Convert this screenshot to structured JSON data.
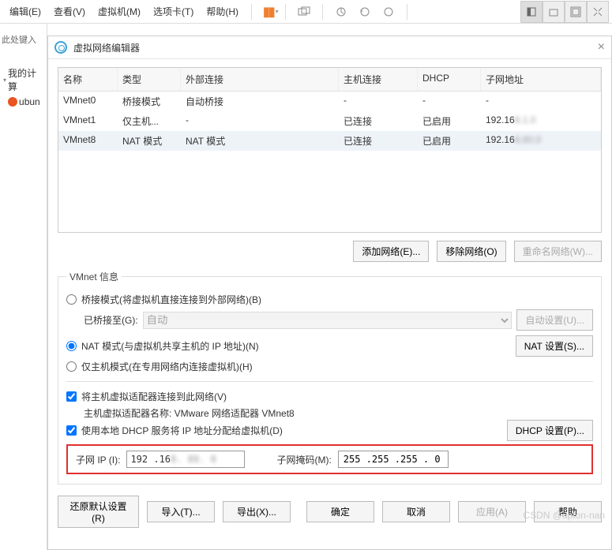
{
  "menubar": {
    "edit": "编辑(E)",
    "view": "查看(V)",
    "vm": "虚拟机(M)",
    "tabs": "选项卡(T)",
    "help": "帮助(H)"
  },
  "left": {
    "search_ph": "此处键入",
    "my_computer": "我的计算",
    "ubuntu": "ubun"
  },
  "dialog": {
    "title": "虚拟网络编辑器",
    "headers": {
      "name": "名称",
      "type": "类型",
      "ext": "外部连接",
      "host": "主机连接",
      "dhcp": "DHCP",
      "subnet": "子网地址"
    },
    "rows": [
      {
        "name": "VMnet0",
        "type": "桥接模式",
        "ext": "自动桥接",
        "host": "-",
        "dhcp": "-",
        "subnet": "-"
      },
      {
        "name": "VMnet1",
        "type": "仅主机...",
        "ext": "-",
        "host": "已连接",
        "dhcp": "已启用",
        "subnet": "192.16",
        "subnet_blur": "8.1.0"
      },
      {
        "name": "VMnet8",
        "type": "NAT 模式",
        "ext": "NAT 模式",
        "host": "已连接",
        "dhcp": "已启用",
        "subnet": "192.16",
        "subnet_blur": "8.80.0"
      }
    ],
    "add_net": "添加网络(E)...",
    "remove_net": "移除网络(O)",
    "rename_net": "重命名网络(W)...",
    "info_legend": "VMnet 信息",
    "bridge_radio": "桥接模式(将虚拟机直接连接到外部网络)(B)",
    "bridge_to": "已桥接至(G):",
    "bridge_select": "自动",
    "auto_set": "自动设置(U)...",
    "nat_radio": "NAT 模式(与虚拟机共享主机的 IP 地址)(N)",
    "nat_set": "NAT 设置(S)...",
    "hostonly_radio": "仅主机模式(在专用网络内连接虚拟机)(H)",
    "conn_host": "将主机虚拟适配器连接到此网络(V)",
    "adapter_label": "主机虚拟适配器名称: VMware 网络适配器 VMnet8",
    "use_dhcp": "使用本地 DHCP 服务将 IP 地址分配给虚拟机(D)",
    "dhcp_set": "DHCP 设置(P)...",
    "subnet_ip_label": "子网 IP (I):",
    "subnet_ip_val": "192 .16",
    "mask_label": "子网掩码(M):",
    "mask_val": "255 .255 .255 . 0",
    "restore": "还原默认设置(R)",
    "import": "导入(T)...",
    "export": "导出(X)...",
    "ok": "确定",
    "cancel": "取消",
    "apply": "应用(A)",
    "helpbtn": "帮助"
  },
  "watermark": "CSDN @upton-nan"
}
